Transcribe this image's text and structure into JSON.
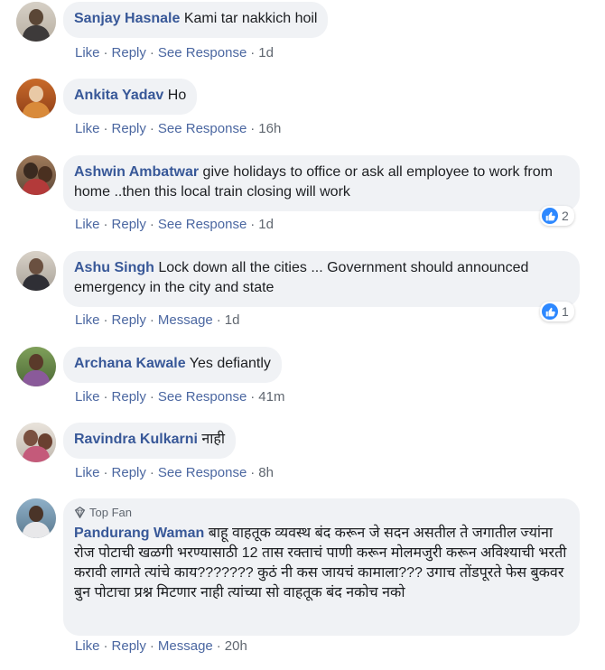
{
  "comments": [
    {
      "name": "Sanjay Hasnale",
      "text": "Kami tar nakkich hoil",
      "actions": {
        "like": "Like",
        "reply": "Reply",
        "extra": "See Response"
      },
      "time": "1d"
    },
    {
      "name": "Ankita Yadav",
      "text": "Ho",
      "actions": {
        "like": "Like",
        "reply": "Reply",
        "extra": "See Response"
      },
      "time": "16h"
    },
    {
      "name": "Ashwin Ambatwar",
      "text": "give holidays to office or ask all employee to work from home ..then this local train closing will work",
      "actions": {
        "like": "Like",
        "reply": "Reply",
        "extra": "See Response"
      },
      "time": "1d",
      "reactions": "2"
    },
    {
      "name": "Ashu Singh",
      "text": "Lock down all the cities ... Government should announced emergency in the city and state",
      "actions": {
        "like": "Like",
        "reply": "Reply",
        "extra": "Message"
      },
      "time": "1d",
      "reactions": "1"
    },
    {
      "name": "Archana Kawale",
      "text": "Yes defiantly",
      "actions": {
        "like": "Like",
        "reply": "Reply",
        "extra": "See Response"
      },
      "time": "41m"
    },
    {
      "name": "Ravindra Kulkarni",
      "text": "नाही",
      "actions": {
        "like": "Like",
        "reply": "Reply",
        "extra": "See Response"
      },
      "time": "8h"
    },
    {
      "badge": "Top Fan",
      "name": "Pandurang Waman",
      "text": "बाहू वाहतूक व्यवस्थ बंद करून जे सदन असतील ते जगातील ज्यांना रोज पोटाची खळगी भरण्यासाठी 12 तास रक्ताचं पाणी करून मोलमजुरी करून अविश्याची भरती करावी लागते त्यांचे काय??????? कुठं नी कस जायचं कामाला??? उगाच तोंडपूरते फेस बुकवर बुन पोटाचा प्रश्न मिटणार नाही त्यांच्या सो वाहतूक बंद नकोच नको",
      "actions": {
        "like": "Like",
        "reply": "Reply",
        "extra": "Message"
      },
      "time": "20h"
    }
  ],
  "separator": "·",
  "colors": {
    "name": "#385898",
    "bubble": "#f0f2f5",
    "like_blue": "#2d88ff"
  }
}
